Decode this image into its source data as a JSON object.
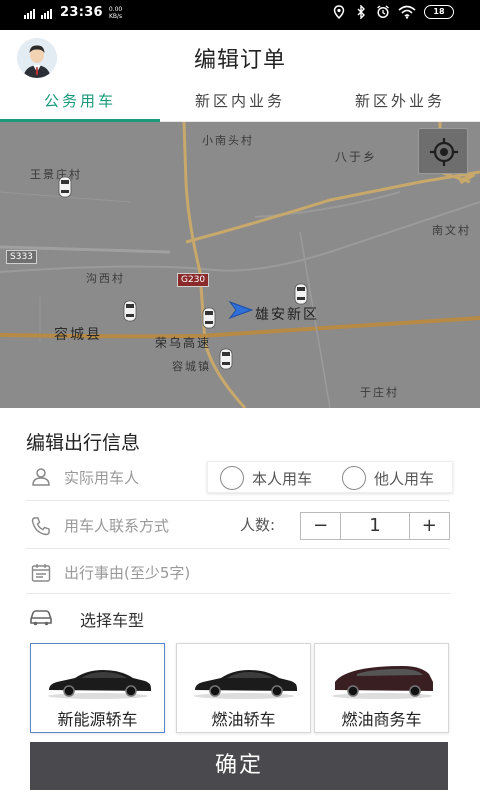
{
  "status_bar": {
    "network1": "4G HD",
    "network2": "4G+HD",
    "time": "23:36",
    "speed_value": "0.00",
    "speed_unit": "KB/s",
    "battery": "18"
  },
  "header": {
    "title": "编辑订单"
  },
  "tabs": [
    {
      "label": "公务用车",
      "active": true
    },
    {
      "label": "新区内业务",
      "active": false
    },
    {
      "label": "新区外业务",
      "active": false
    }
  ],
  "map": {
    "labels": {
      "xiaonantou": "小南头村",
      "bayu": "八于乡",
      "wangjingzhuang": "王景庄村",
      "nanwen": "南文村",
      "jiaoxi": "沟西村",
      "rongcheng_county": "容城县",
      "xiongan": "雄安新区",
      "rongwu": "荣乌高速",
      "rongcheng_town": "容城镇",
      "yuzhuang": "于庄村"
    },
    "road_tags": {
      "s333": "S333",
      "g230": "G230"
    }
  },
  "form": {
    "title": "编辑出行信息",
    "user_placeholder": "实际用车人",
    "radio_self": "本人用车",
    "radio_other": "他人用车",
    "contact_placeholder": "用车人联系方式",
    "people_label": "人数:",
    "stepper": {
      "minus": "−",
      "value": "1",
      "plus": "+"
    },
    "reason_placeholder": "出行事由(至少5字)",
    "select_car_label": "选择车型"
  },
  "car_types": [
    {
      "label": "新能源轿车",
      "selected": true
    },
    {
      "label": "燃油轿车",
      "selected": false
    },
    {
      "label": "燃油商务车",
      "selected": false
    }
  ],
  "confirm_label": "确定",
  "colors": {
    "accent": "#1a9a7a",
    "confirm_bg": "#4a4a4e",
    "selected_border": "#5a86c8"
  }
}
